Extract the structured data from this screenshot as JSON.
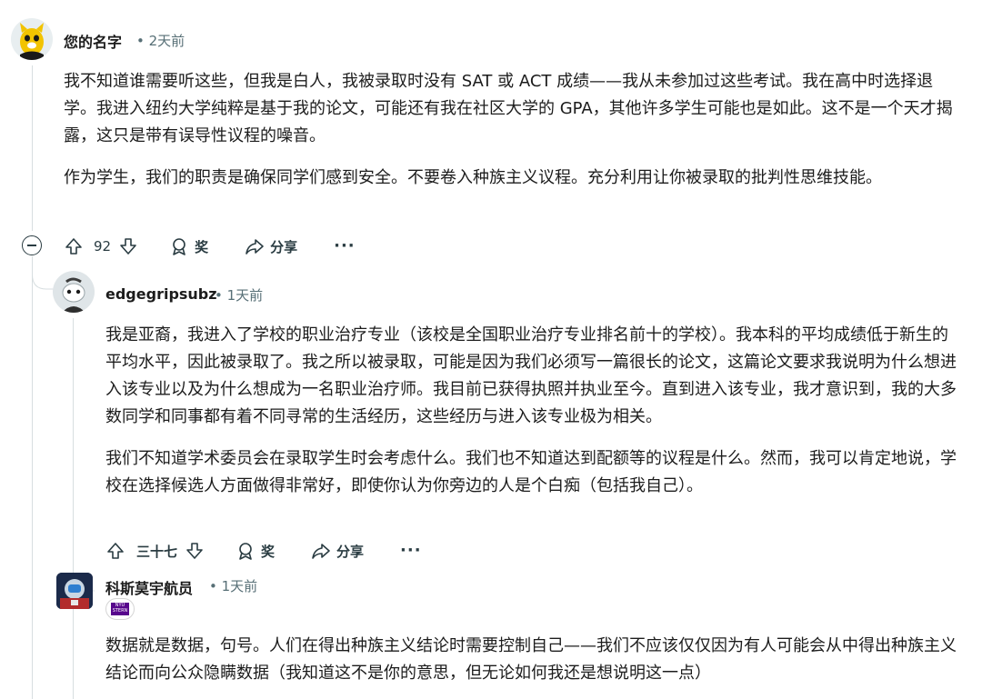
{
  "comments": [
    {
      "author": "您的名字",
      "time": "• 2天前",
      "paragraphs": [
        "我不知道谁需要听这些，但我是白人，我被录取时没有 SAT 或 ACT 成绩——我从未参加过这些考试。我在高中时选择退学。我进入纽约大学纯粹是基于我的论文，可能还有我在社区大学的 GPA，其他许多学生可能也是如此。这不是一个天才揭露，这只是带有误导性议程的噪音。",
        "作为学生，我们的职责是确保同学们感到安全。不要卷入种族主义议程。充分利用让你被录取的批判性思维技能。"
      ],
      "votes": "92",
      "award_label": "奖",
      "share_label": "分享",
      "more_label": "···"
    },
    {
      "author": "edgegripsubz",
      "time": "• 1天前",
      "paragraphs": [
        "我是亚裔，我进入了学校的职业治疗专业（该校是全国职业治疗专业排名前十的学校）。我本科的平均成绩低于新生的平均水平，因此被录取了。我之所以被录取，可能是因为我们必须写一篇很长的论文，这篇论文要求我说明为什么想进入该专业以及为什么想成为一名职业治疗师。我目前已获得执照并执业至今。直到进入该专业，我才意识到，我的大多数同学和同事都有着不同寻常的生活经历，这些经历与进入该专业极为相关。",
        "我们不知道学术委员会在录取学生时会考虑什么。我们也不知道达到配额等的议程是什么。然而，我可以肯定地说，学校在选择候选人方面做得非常好，即使你认为你旁边的人是个白痴（包括我自己）。"
      ],
      "votes": "三十七",
      "award_label": "奖",
      "share_label": "分享",
      "more_label": "···"
    },
    {
      "author": "科斯莫宇航员",
      "time": "• 1天前",
      "flair_text": "NYU STERN",
      "paragraphs": [
        "数据就是数据，句号。人们在得出种族主义结论时需要控制自己——我们不应该仅仅因为有人可能会从中得出种族主义结论而向公众隐瞒数据（我知道这不是你的意思，但无论如何我还是想说明这一点）"
      ]
    }
  ],
  "colors": {
    "text": "#1c1c1c",
    "meta": "#576f76",
    "thread_line": "#d7dee0",
    "flair_bg": "#57068c"
  }
}
